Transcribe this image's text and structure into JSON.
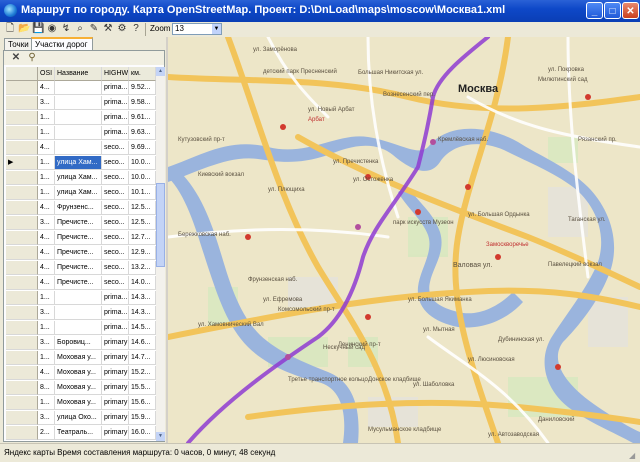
{
  "window": {
    "title": "Маршрут по городу. Карта OpenStreetMap. Проект: D:\\DnLoad\\maps\\moscow\\Москва1.xml",
    "btn_min": "_",
    "btn_max": "□",
    "btn_close": "✕"
  },
  "toolbar": {
    "zoom_label": "Zoom",
    "zoom_value": "13"
  },
  "tabs": {
    "points": "Точки",
    "road_parts": "Участки дорог"
  },
  "grid": {
    "columns": [
      "OSI",
      "Название",
      "HIGHW",
      "км."
    ],
    "rows": [
      {
        "osi": "4...",
        "name": "",
        "highway": "prima...",
        "km": "9.52..."
      },
      {
        "osi": "3...",
        "name": "",
        "highway": "prima...",
        "km": "9.58..."
      },
      {
        "osi": "1...",
        "name": "",
        "highway": "prima...",
        "km": "9.61..."
      },
      {
        "osi": "1...",
        "name": "",
        "highway": "prima...",
        "km": "9.63..."
      },
      {
        "osi": "4...",
        "name": "",
        "highway": "seco...",
        "km": "9.69..."
      },
      {
        "osi": "1...",
        "name": "улица Хам...",
        "highway": "seco...",
        "km": "10.0...",
        "selected": true
      },
      {
        "osi": "1...",
        "name": "улица Хам...",
        "highway": "seco...",
        "km": "10.0..."
      },
      {
        "osi": "1...",
        "name": "улица Хам...",
        "highway": "seco...",
        "km": "10.1..."
      },
      {
        "osi": "4...",
        "name": "Фрунзенс...",
        "highway": "seco...",
        "km": "12.5..."
      },
      {
        "osi": "3...",
        "name": "Пречисте...",
        "highway": "seco...",
        "km": "12.5..."
      },
      {
        "osi": "4...",
        "name": "Пречисте...",
        "highway": "seco...",
        "km": "12.7..."
      },
      {
        "osi": "4...",
        "name": "Пречисте...",
        "highway": "seco...",
        "km": "12.9..."
      },
      {
        "osi": "4...",
        "name": "Пречисте...",
        "highway": "seco...",
        "km": "13.2..."
      },
      {
        "osi": "4...",
        "name": "Пречисте...",
        "highway": "seco...",
        "km": "14.0..."
      },
      {
        "osi": "1...",
        "name": "",
        "highway": "prima...",
        "km": "14.3..."
      },
      {
        "osi": "3...",
        "name": "",
        "highway": "prima...",
        "km": "14.3..."
      },
      {
        "osi": "1...",
        "name": "",
        "highway": "prima...",
        "km": "14.5..."
      },
      {
        "osi": "3...",
        "name": "Боровиц...",
        "highway": "primary",
        "km": "14.6..."
      },
      {
        "osi": "1...",
        "name": "Моховая у...",
        "highway": "primary",
        "km": "14.7..."
      },
      {
        "osi": "4...",
        "name": "Моховая у...",
        "highway": "primary",
        "km": "15.2..."
      },
      {
        "osi": "8...",
        "name": "Моховая у...",
        "highway": "primary",
        "km": "15.5..."
      },
      {
        "osi": "1...",
        "name": "Моховая у...",
        "highway": "primary",
        "km": "15.6..."
      },
      {
        "osi": "3...",
        "name": "улица Охо...",
        "highway": "primary",
        "km": "15.9..."
      },
      {
        "osi": "2...",
        "name": "Театраль...",
        "highway": "primary",
        "km": "16.0..."
      }
    ]
  },
  "map": {
    "labels": {
      "moscow": "Москва",
      "arbat": "Арбат",
      "novy_arbat": "ул. Новый Арбат",
      "zamoskvorechye": "Замоскворечье",
      "prechistenka": "ул. Пречистенка",
      "kievsky": "Киевский вокзал",
      "paveletsky": "Павелецкий вокзал",
      "valovaya": "Валовая ул.",
      "leninsky": "Ленинский пр-т",
      "khamovnichesky": "ул. Хамовнический Вал",
      "komsomolsky": "Комсомольский пр-т",
      "frunzenskaya": "Фрунзенская наб.",
      "muzeon": "парк искусств Музеон",
      "neskuchny": "Нескучный сад",
      "donskoe": "Донское кладбище",
      "danilovsky": "Даниловский",
      "muslim": "Мусульманское кладбище",
      "taganskaya": "Таганская ул.",
      "pokrovka": "ул. Покровка",
      "nikitskaya": "Большая Никитская ул.",
      "kutuzovsky": "Кутузовский пр-т",
      "berezhkovskaya": "Бережковская наб.",
      "dubininskaya": "Дубининская ул.",
      "avtozavodskaya": "ул. Автозаводская",
      "ostozhenka": "ул. Остоженка",
      "plyushchikha": "ул. Плющиха",
      "yakimanka": "ул. Большая Якиманка",
      "ordynka": "ул. Большая Ордынка",
      "lyusinovskaya": "ул. Люсиновская",
      "shabolovka": "ул. Шаболовка",
      "tretyakovsky": "Третье транспортное кольцо",
      "mytnaya": "ул. Мытная",
      "kremlin_embankment": "Кремлёвская наб.",
      "efremova": "ул. Ефремова",
      "childrens_park": "детский парк Пресненский",
      "mil_sad": "Милютинский сад",
      "zamorenova": "ул. Заморёнова",
      "vysotsky": "Вознесенский пер.",
      "ryazansky": "Рязанский пр."
    }
  },
  "status": {
    "text": "Яндекс карты   Время составления маршрута: 0 часов, 0 минут, 48 секунд"
  }
}
